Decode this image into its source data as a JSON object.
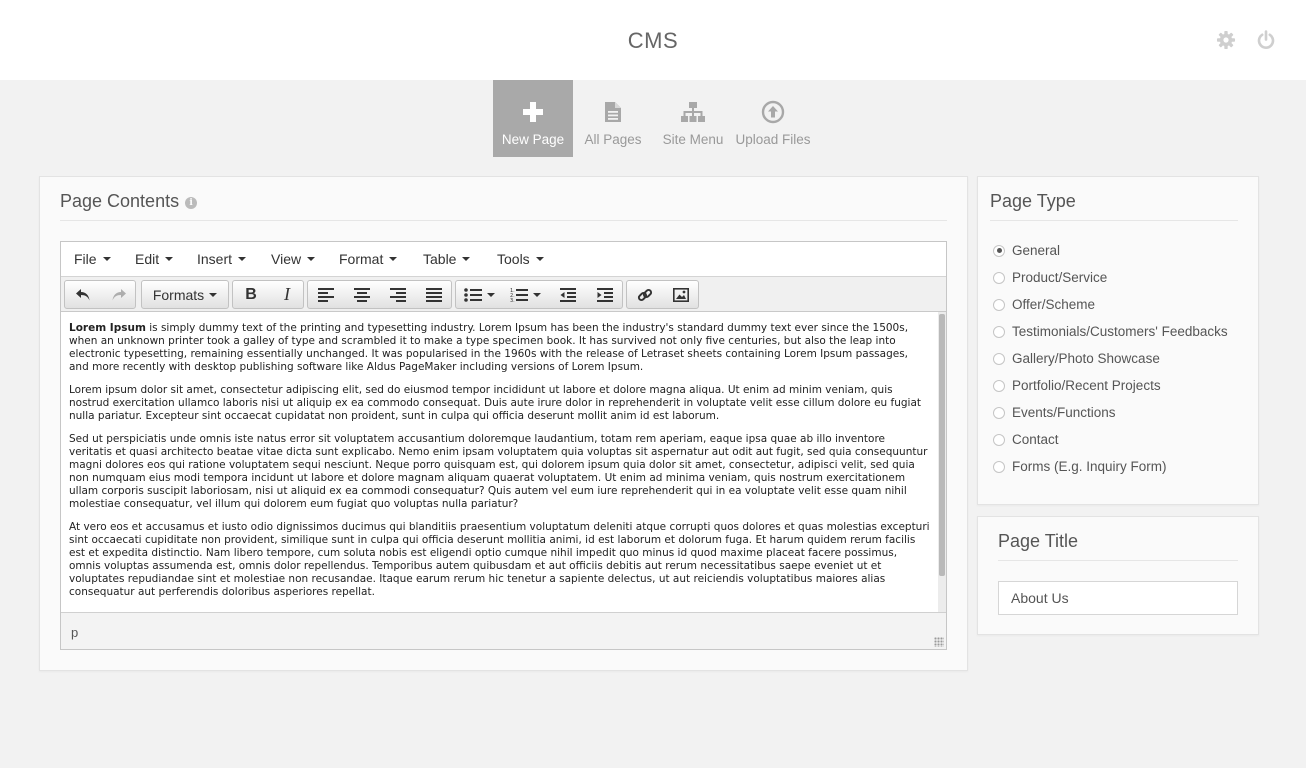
{
  "app": {
    "title": "CMS"
  },
  "header_icons": {
    "settings": "gear-icon",
    "power": "power-icon"
  },
  "nav": {
    "tabs": [
      {
        "label": "New Page",
        "icon": "plus-icon",
        "active": true
      },
      {
        "label": "All Pages",
        "icon": "document-icon",
        "active": false
      },
      {
        "label": "Site Menu",
        "icon": "sitemap-icon",
        "active": false
      },
      {
        "label": "Upload Files",
        "icon": "upload-icon",
        "active": false
      }
    ]
  },
  "page_contents": {
    "title": "Page Contents",
    "editor": {
      "menu": [
        "File",
        "Edit",
        "Insert",
        "View",
        "Format",
        "Table",
        "Tools"
      ],
      "formats_label": "Formats",
      "paragraphs": [
        {
          "bold": "Lorem Ipsum",
          "text": " is simply dummy text of the printing and typesetting industry. Lorem Ipsum has been the industry's standard dummy text ever since the 1500s, when an unknown printer took a galley of type and scrambled it to make a type specimen book. It has survived not only five centuries, but also the leap into electronic typesetting, remaining essentially unchanged. It was popularised in the 1960s with the release of Letraset sheets containing Lorem Ipsum passages, and more recently with desktop publishing software like Aldus PageMaker including versions of Lorem Ipsum."
        },
        {
          "bold": "",
          "text": "Lorem ipsum dolor sit amet, consectetur adipiscing elit, sed do eiusmod tempor incididunt ut labore et dolore magna aliqua. Ut enim ad minim veniam, quis nostrud exercitation ullamco laboris nisi ut aliquip ex ea commodo consequat. Duis aute irure dolor in reprehenderit in voluptate velit esse cillum dolore eu fugiat nulla pariatur. Excepteur sint occaecat cupidatat non proident, sunt in culpa qui officia deserunt mollit anim id est laborum."
        },
        {
          "bold": "",
          "text": "Sed ut perspiciatis unde omnis iste natus error sit voluptatem accusantium doloremque laudantium, totam rem aperiam, eaque ipsa quae ab illo inventore veritatis et quasi architecto beatae vitae dicta sunt explicabo. Nemo enim ipsam voluptatem quia voluptas sit aspernatur aut odit aut fugit, sed quia consequuntur magni dolores eos qui ratione voluptatem sequi nesciunt. Neque porro quisquam est, qui dolorem ipsum quia dolor sit amet, consectetur, adipisci velit, sed quia non numquam eius modi tempora incidunt ut labore et dolore magnam aliquam quaerat voluptatem. Ut enim ad minima veniam, quis nostrum exercitationem ullam corporis suscipit laboriosam, nisi ut aliquid ex ea commodi consequatur? Quis autem vel eum iure reprehenderit qui in ea voluptate velit esse quam nihil molestiae consequatur, vel illum qui dolorem eum fugiat quo voluptas nulla pariatur?"
        },
        {
          "bold": "",
          "text": "At vero eos et accusamus et iusto odio dignissimos ducimus qui blanditiis praesentium voluptatum deleniti atque corrupti quos dolores et quas molestias excepturi sint occaecati cupiditate non provident, similique sunt in culpa qui officia deserunt mollitia animi, id est laborum et dolorum fuga. Et harum quidem rerum facilis est et expedita distinctio. Nam libero tempore, cum soluta nobis est eligendi optio cumque nihil impedit quo minus id quod maxime placeat facere possimus, omnis voluptas assumenda est, omnis dolor repellendus. Temporibus autem quibusdam et aut officiis debitis aut rerum necessitatibus saepe eveniet ut et voluptates repudiandae sint et molestiae non recusandae. Itaque earum rerum hic tenetur a sapiente delectus, ut aut reiciendis voluptatibus maiores alias consequatur aut perferendis doloribus asperiores repellat."
        }
      ],
      "status_path": "p"
    }
  },
  "page_type": {
    "title": "Page Type",
    "selected": "General",
    "options": [
      "General",
      "Product/Service",
      "Offer/Scheme",
      "Testimonials/Customers' Feedbacks",
      "Gallery/Photo Showcase",
      "Portfolio/Recent Projects",
      "Events/Functions",
      "Contact",
      "Forms (E.g. Inquiry Form)"
    ]
  },
  "page_title": {
    "title": "Page Title",
    "value": "About Us"
  }
}
